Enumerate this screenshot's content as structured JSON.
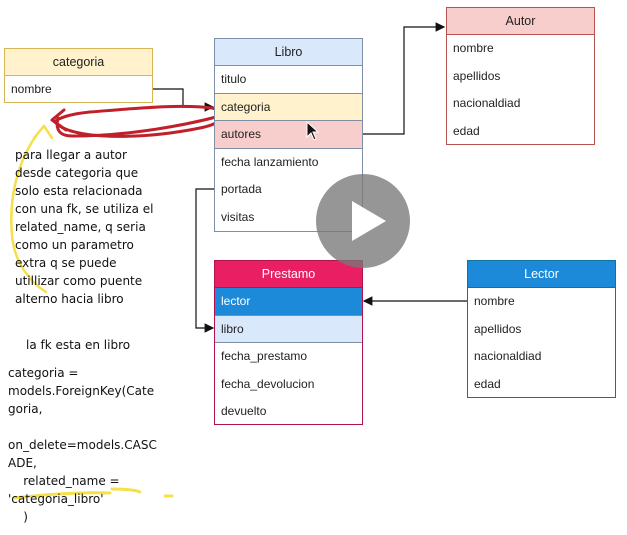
{
  "entities": {
    "categoria": {
      "title": "categoria",
      "rows": [
        "nombre"
      ],
      "head_color": "#fff2cc",
      "border": "#d6b656"
    },
    "libro": {
      "title": "Libro",
      "rows": [
        "titulo",
        "categoria",
        "autores",
        "fecha lanzamiento",
        "portada",
        "visitas"
      ],
      "head_color": "#dae8fc",
      "highlight_categoria": "#fff2cc",
      "highlight_autores": "#f8cecc"
    },
    "autor": {
      "title": "Autor",
      "rows": [
        "nombre",
        "apellidos",
        "nacionaldiad",
        "edad"
      ],
      "head_color": "#f8cecc"
    },
    "prestamo": {
      "title": "Prestamo",
      "rows": [
        "lector",
        "libro",
        "fecha_prestamo",
        "fecha_devolucion",
        "devuelto"
      ],
      "head_color": "#e91e63",
      "lector_color": "#1c8ad8",
      "libro_color": "#dae8fc"
    },
    "lector": {
      "title": "Lector",
      "rows": [
        "nombre",
        "apellidos",
        "nacionaldiad",
        "edad"
      ],
      "head_color": "#1c8ad8"
    }
  },
  "notes": {
    "explanation": "para llegar a autor\ndesde categoria que\nsolo esta relacionada\ncon una fk, se utiliza el\nrelated_name, q seria\ncomo un parametro\nextra q se puede\nutillizar como puente\nalterno hacia libro",
    "fk_location": "la fk esta en libro",
    "code": "categoria =\nmodels.ForeignKey(Cate\ngoria,\n\non_delete=models.CASC\nADE,\n    related_name =\n'categoria_libro'\n    )"
  },
  "annotation_colors": {
    "red_scribble": "#c0202a",
    "yellow_highlight": "#f6e04a"
  },
  "video": {
    "icon": "play-icon"
  }
}
